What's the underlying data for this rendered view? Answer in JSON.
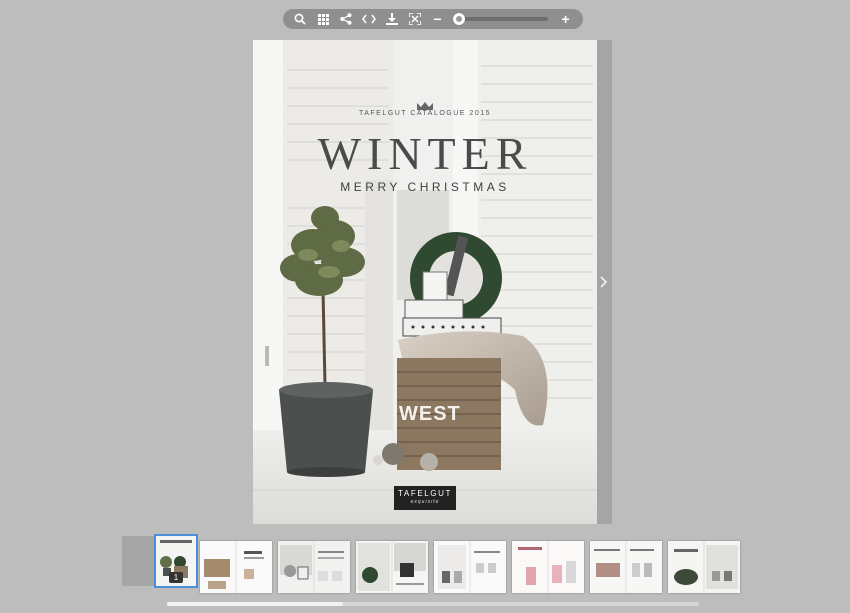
{
  "toolbar": {
    "buttons": [
      "search-icon",
      "grid-icon",
      "share-icon",
      "embed-code-icon",
      "download-icon",
      "fullscreen-icon"
    ],
    "zoom_out_label": "−",
    "zoom_in_label": "+",
    "zoom_level": 0.0
  },
  "cover": {
    "catalogue": "TAFELGUT CATALOGUE 2015",
    "title": "WINTER",
    "subtitle": "MERRY CHRISTMAS",
    "brand_name": "TAFELGUT",
    "brand_tagline": "exquisite",
    "basket_text": "WEST"
  },
  "thumbnails": {
    "current_page": "1",
    "count": 8
  },
  "colors": {
    "background": "#bdbdbd",
    "toolbar": "#8f8f8f",
    "active_thumb": "#4a90d9"
  }
}
